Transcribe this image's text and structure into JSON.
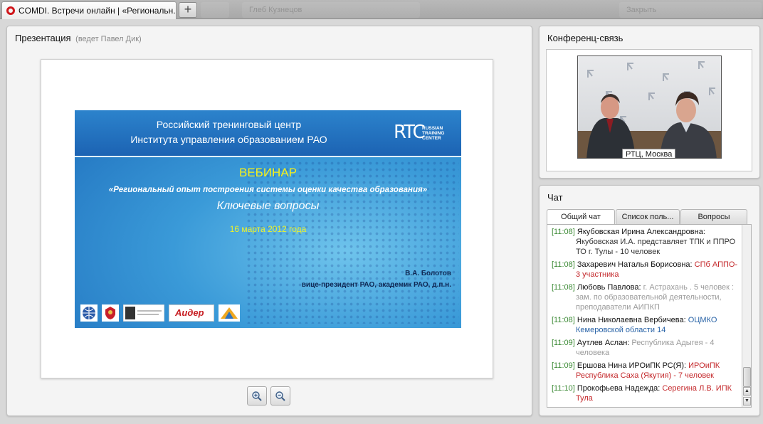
{
  "browser": {
    "active_tab_title": "COMDI. Встречи онлайн | «Региональн...",
    "new_tab_label": "+",
    "ghost_tabs": [
      "",
      "Глеб Кузнецов",
      "Закрыть"
    ]
  },
  "presentation": {
    "title": "Презентация",
    "presenter": "(ведет Павел Дик)",
    "slide": {
      "org_line1": "Российский тренинговый центр",
      "org_line2": "Института управления образованием РАО",
      "logo_letters": "RTC",
      "logo_caption_1": "RUSSIAN",
      "logo_caption_2": "TRAINING",
      "logo_caption_3": "CENTER",
      "webinar": "ВЕБИНАР",
      "topic": "«Региональный опыт построения системы оценки качества образования»",
      "key_questions": "Ключевые вопросы",
      "date": "16 марта 2012 года",
      "author": "В.А. Болотов",
      "author_role": "вице-президент РАО, академик РАО, д.п.н.",
      "logo_aider": "Аидер"
    },
    "zoom_in_icon": "zoom-in-icon",
    "zoom_out_icon": "zoom-out-icon"
  },
  "conference": {
    "title": "Конференц-связь",
    "video_caption": "РТЦ,   Москва"
  },
  "chat": {
    "title": "Чат",
    "tabs": [
      "Общий чат",
      "Список поль...",
      "Вопросы"
    ],
    "messages": [
      {
        "time": "[11:08]",
        "sender": "Якубовская Ирина Александровна:",
        "text": "Якубовская И.А. представляет ТПК и ППРО ТО г. Тулы - 10 человек",
        "color": "c-dark"
      },
      {
        "time": "[11:08]",
        "sender": "Захаревич Наталья Борисовна:",
        "text": "СПб АППО- 3 участника",
        "color": "c-red"
      },
      {
        "time": "[11:08]",
        "sender": "Любовь Павлова:",
        "text": "г. Астрахань . 5 человек : зам. по образовательной деятельности, преподаватели АИПКП",
        "color": "c-gray"
      },
      {
        "time": "[11:08]",
        "sender": "Нина Николаевна Вербичева:",
        "text": "ОЦМКО Кемеровской области 14",
        "color": "c-blue"
      },
      {
        "time": "[11:09]",
        "sender": "Аутлев Аслан:",
        "text": "Республика Адыгея - 4 человека",
        "color": "c-gray"
      },
      {
        "time": "[11:09]",
        "sender": "Ершова Нина ИРОиПК РС(Я):",
        "text": "ИРОиПК Республика Саха (Якутия) - 7 человек",
        "color": "c-red"
      },
      {
        "time": "[11:10]",
        "sender": "Прокофьева Надежда:",
        "text": "Серегина Л.В. ИПК Тула",
        "color": "c-red"
      }
    ]
  }
}
